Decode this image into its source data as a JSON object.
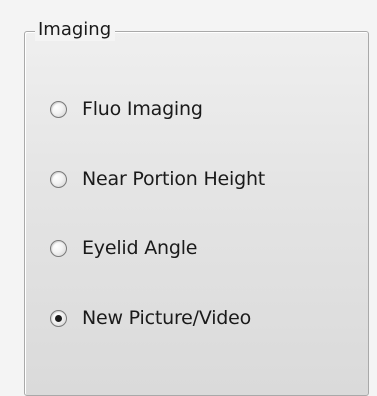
{
  "group": {
    "title": "Imaging"
  },
  "options": [
    {
      "label": "Fluo Imaging",
      "checked": false
    },
    {
      "label": "Near Portion Height",
      "checked": false
    },
    {
      "label": "Eyelid Angle",
      "checked": false
    },
    {
      "label": "New Picture/Video",
      "checked": true
    }
  ]
}
